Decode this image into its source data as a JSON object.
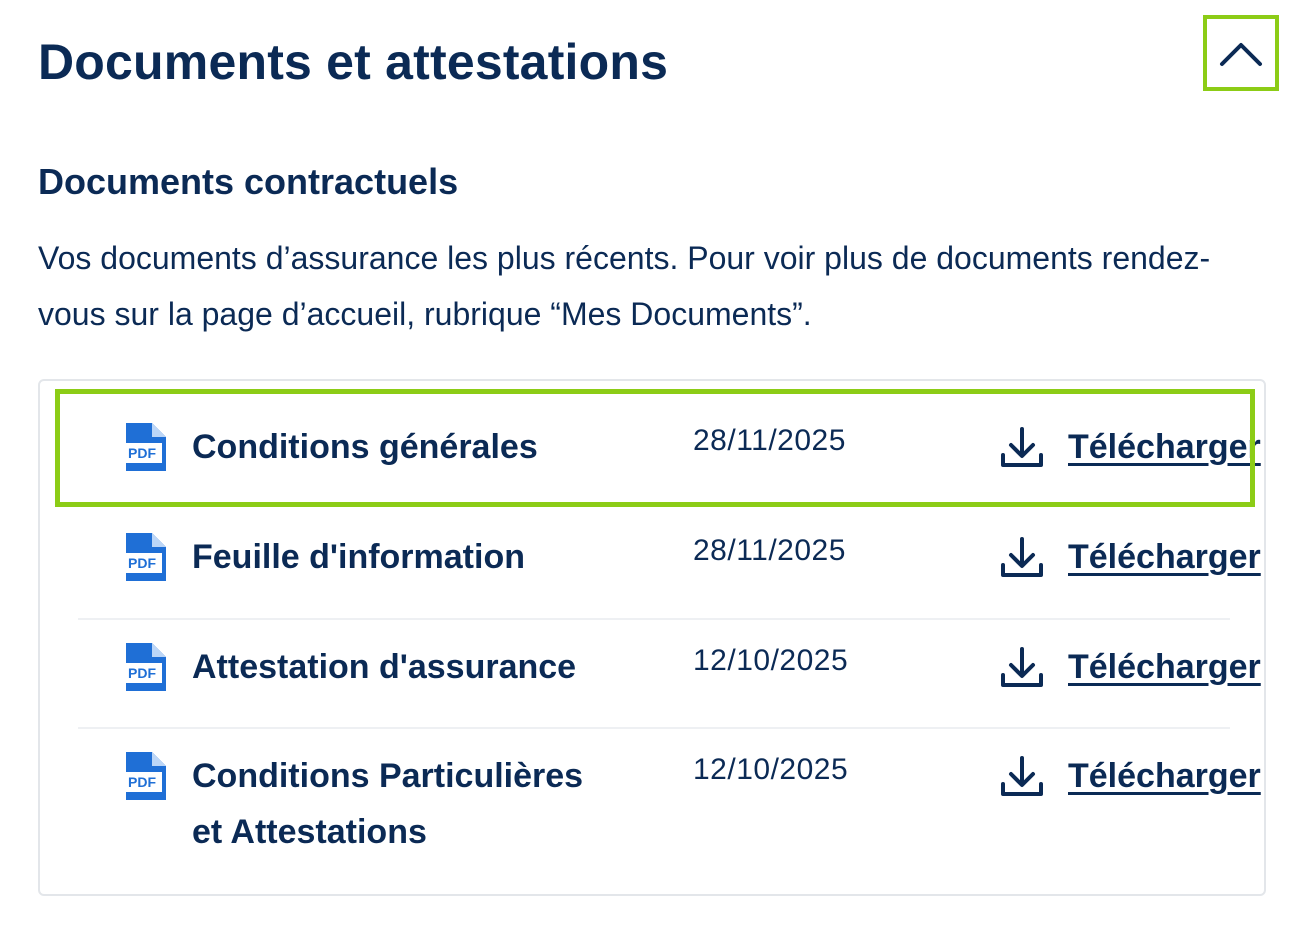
{
  "page": {
    "title": "Documents et attestations"
  },
  "section": {
    "title": "Documents contractuels",
    "description": "Vos documents d’assurance les plus récents. Pour voir plus de documents rendez-vous sur la page d’accueil, rubrique “Mes Documents”."
  },
  "icons": {
    "file": "pdf-icon",
    "download": "download-icon",
    "collapse": "chevron-up-icon",
    "pdf_label": "PDF"
  },
  "colors": {
    "text": "#0b2a55",
    "pdf_blue": "#1f6fd6",
    "focus_outline": "#8ccc16",
    "card_border": "#e3e6ea"
  },
  "documents": [
    {
      "name": "Conditions générales",
      "date": "28/11/2025",
      "action": "Télécharger"
    },
    {
      "name": "Feuille d'information",
      "date": "28/11/2025",
      "action": "Télécharger"
    },
    {
      "name": "Attestation d'assurance",
      "date": "12/10/2025",
      "action": "Télécharger"
    },
    {
      "name": "Conditions Particulières et Attestations",
      "date": "12/10/2025",
      "action": "Télécharger"
    }
  ]
}
